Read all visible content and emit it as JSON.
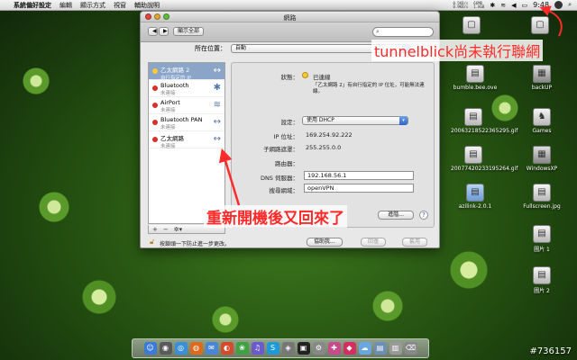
{
  "menubar": {
    "apple": "",
    "items": [
      "系統偏好設定",
      "編輯",
      "顯示方式",
      "視窗",
      "輔助說明"
    ],
    "net_up": "0.5KB/s",
    "net_down": "0.9KB/s",
    "mem_a": "66MB",
    "mem_b": "1.8GB",
    "clock": "9:48"
  },
  "window": {
    "title": "網路",
    "show_all": "顯示全部",
    "search_placeholder": "",
    "location_label": "所在位置：",
    "location_value": "自動"
  },
  "services": [
    {
      "name": "乙太網路 2",
      "status": "自行指定的 IP",
      "color": "#ffcc33",
      "icon": "↔",
      "selected": true
    },
    {
      "name": "Bluetooth",
      "status": "未連接",
      "color": "#d9302c",
      "icon": "✱",
      "selected": false
    },
    {
      "name": "AirPort",
      "status": "未連接",
      "color": "#d9302c",
      "icon": "≋",
      "selected": false
    },
    {
      "name": "Bluetooth PAN",
      "status": "未連接",
      "color": "#d9302c",
      "icon": "↔",
      "selected": false
    },
    {
      "name": "乙太網路",
      "status": "未連接",
      "color": "#d9302c",
      "icon": "↔",
      "selected": false
    }
  ],
  "sidebar_controls": {
    "add": "+",
    "remove": "−",
    "action": "✲▾"
  },
  "detail": {
    "status_label": "狀態：",
    "status_value": "已連線",
    "status_desc_1": "「乙太網路 2」有自行指定的 IP 位址，可能無法連",
    "status_desc_2": "線。",
    "configure_label": "設定：",
    "configure_value": "使用 DHCP",
    "ip_label": "IP 位址：",
    "ip_value": "169.254.92.222",
    "subnet_label": "子網路遮罩：",
    "subnet_value": "255.255.0.0",
    "router_label": "路由器：",
    "router_value": "",
    "dns_label": "DNS 伺服器：",
    "dns_value": "192.168.56.1",
    "search_domains_label": "搜尋網域：",
    "search_domains_value": "openVPN",
    "advanced": "進階...",
    "help": "?"
  },
  "footer": {
    "lock_text": "按鎖頭一下防止進一步更改。",
    "assist": "協助我...",
    "revert": "回復",
    "apply": "套用"
  },
  "desktop_icons": [
    {
      "label": "",
      "glyph": "▢"
    },
    {
      "label": "",
      "glyph": "▢"
    },
    {
      "label": "bumble.bee.ove",
      "glyph": "▤"
    },
    {
      "label": "backUP",
      "glyph": "▦"
    },
    {
      "label": "20063218522365295.gif",
      "glyph": "▤"
    },
    {
      "label": "Games",
      "glyph": "♞"
    },
    {
      "label": "20077420233195264.gif",
      "glyph": "▤"
    },
    {
      "label": "WindowsXP",
      "glyph": "▦"
    },
    {
      "label": "azilink-2.0.1",
      "glyph": "▤"
    },
    {
      "label": "Fullscreen.jpg",
      "glyph": "▤"
    },
    {
      "label": "圖片 1",
      "glyph": "▤"
    },
    {
      "label": "圖片 2",
      "glyph": "▤"
    }
  ],
  "annotations": {
    "top": "tunnelblick尚未執行聯網",
    "middle": "重新開機後又回來了",
    "color": "#ff2a2a"
  },
  "dock": [
    {
      "glyph": "☺",
      "color": "#3a7bd5"
    },
    {
      "glyph": "◉",
      "color": "#5a5a5a"
    },
    {
      "glyph": "◎",
      "color": "#3b8fd6"
    },
    {
      "glyph": "◍",
      "color": "#e06a1b"
    },
    {
      "glyph": "✉",
      "color": "#4a86d6"
    },
    {
      "glyph": "◐",
      "color": "#d64a2c"
    },
    {
      "glyph": "❀",
      "color": "#3fa142"
    },
    {
      "glyph": "♫",
      "color": "#6a5acd"
    },
    {
      "glyph": "S",
      "color": "#1f9ad6"
    },
    {
      "glyph": "◈",
      "color": "#777777"
    },
    {
      "glyph": "▣",
      "color": "#222222"
    },
    {
      "glyph": "⚙",
      "color": "#888888"
    },
    {
      "glyph": "✚",
      "color": "#c84a8a"
    },
    {
      "glyph": "◆",
      "color": "#d62c5f"
    },
    {
      "glyph": "☁",
      "color": "#6aa6e0"
    },
    {
      "glyph": "▤",
      "color": "#6d8fb5"
    },
    {
      "glyph": "▥",
      "color": "#9a9a9a"
    },
    {
      "glyph": "⌫",
      "color": "#888888"
    }
  ],
  "watermark": "#736157"
}
